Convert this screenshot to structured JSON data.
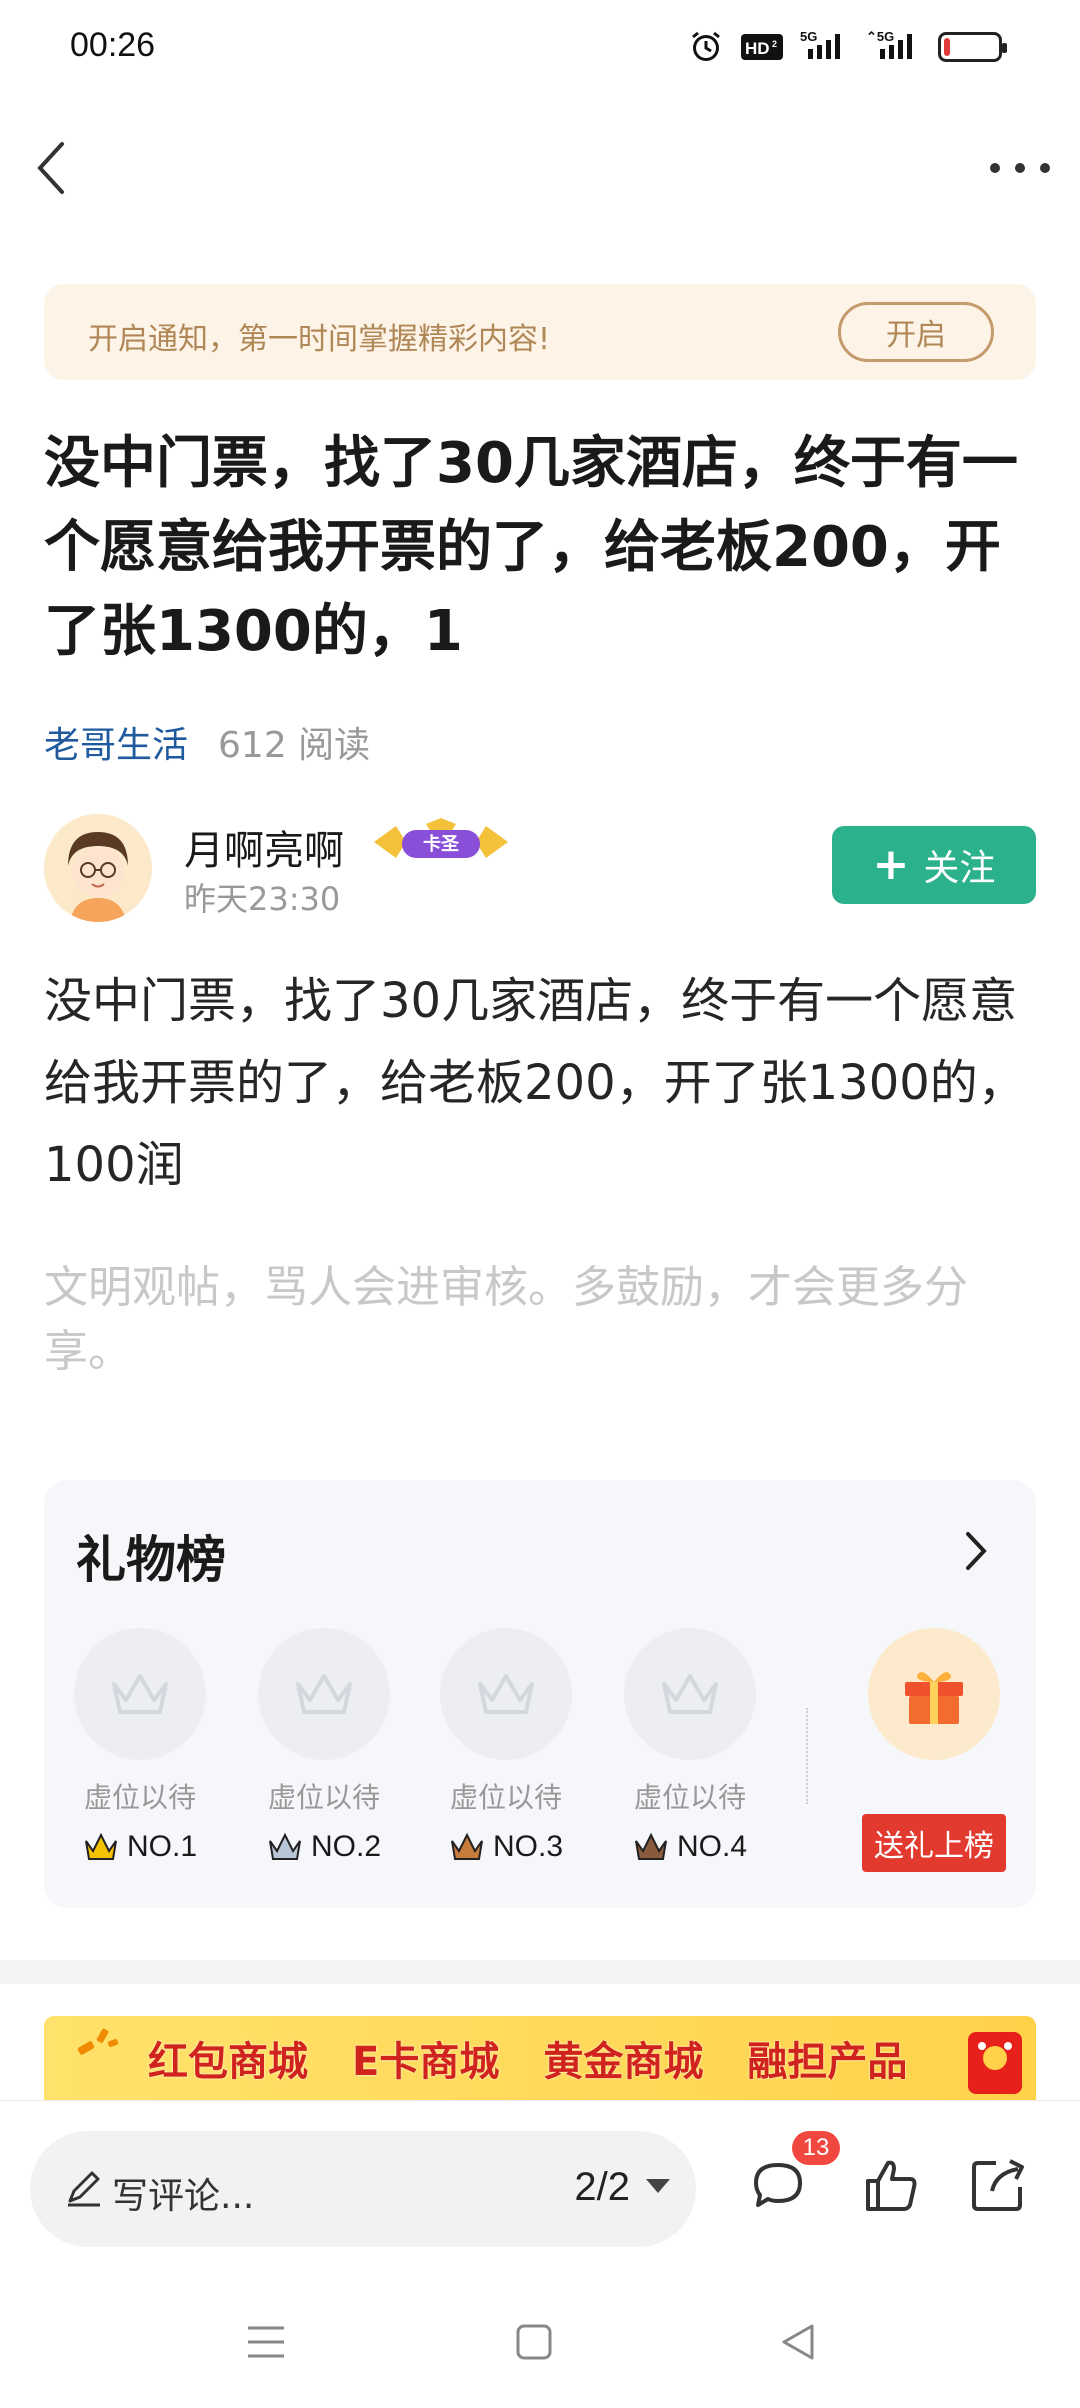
{
  "status_bar": {
    "time": "00:26",
    "icons": [
      "alarm-icon",
      "hd-icon",
      "5g-signal-icon",
      "5g-signal-icon",
      "battery-icon"
    ],
    "hd_label": "HD",
    "net1": "5G",
    "net2": "5G"
  },
  "notice": {
    "text": "开启通知，第一时间掌握精彩内容!",
    "button": "开启"
  },
  "article": {
    "title": "没中门票，找了30几家酒店，终于有一个愿意给我开票的了，给老板200，开了张1300的，1",
    "channel": "老哥生活",
    "reads": "612 阅读",
    "author_name": "月啊亮啊",
    "author_badge": "卡圣",
    "post_time": "昨天23:30",
    "follow_label": "关注",
    "body": "没中门票，找了30几家酒店，终于有一个愿意给我开票的了，给老板200，开了张1300的，100润",
    "tip": "文明观帖，骂人会进审核。多鼓励，才会更多分享。"
  },
  "gift_board": {
    "title": "礼物榜",
    "slots": [
      {
        "label": "虚位以待",
        "rank": "NO.1",
        "color": "#f4c200"
      },
      {
        "label": "虚位以待",
        "rank": "NO.2",
        "color": "#b9c6d6"
      },
      {
        "label": "虚位以待",
        "rank": "NO.3",
        "color": "#c77b3c"
      },
      {
        "label": "虚位以待",
        "rank": "NO.4",
        "color": "#8a5a3c"
      }
    ],
    "send_label": "送礼上榜"
  },
  "ad": {
    "items": [
      "红包商城",
      "E卡商城",
      "黄金商城",
      "融担产品"
    ]
  },
  "bottom_bar": {
    "comment_placeholder": "写评论...",
    "pager": "2/2",
    "comment_count": "13"
  },
  "colors": {
    "accent_green": "#2bb18b",
    "channel_blue": "#1f5a9e",
    "notice_bg": "#fdf3e7",
    "red": "#e33a30"
  }
}
